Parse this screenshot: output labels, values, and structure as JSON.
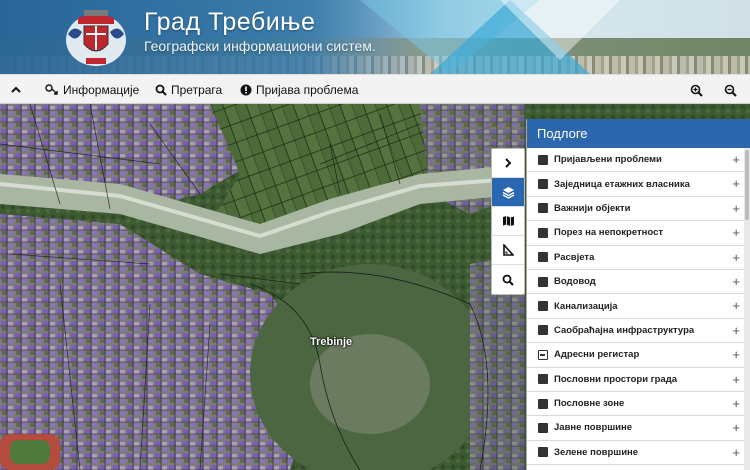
{
  "header": {
    "title": "Град Требиње",
    "subtitle": "Географски информациони систем."
  },
  "toolbar": {
    "collapse_icon": "chevron-up-icon",
    "info_label": "Информације",
    "search_label": "Претрага",
    "report_label": "Пријава проблема",
    "zoom_in_icon": "zoom-in-icon",
    "zoom_out_icon": "zoom-out-icon"
  },
  "map": {
    "place_label": "Trebinje"
  },
  "vtools": [
    "chevron-right-icon",
    "layers-icon",
    "map-icon",
    "measure-icon",
    "search-icon"
  ],
  "panel": {
    "title": "Подлоге",
    "layers": [
      {
        "label": "Пријављени проблеми",
        "state": "checked"
      },
      {
        "label": "Заједница етажних власника",
        "state": "checked"
      },
      {
        "label": "Важнији објекти",
        "state": "checked"
      },
      {
        "label": "Порез на непокретност",
        "state": "checked"
      },
      {
        "label": "Расвјета",
        "state": "checked"
      },
      {
        "label": "Водовод",
        "state": "checked"
      },
      {
        "label": "Канализација",
        "state": "checked"
      },
      {
        "label": "Саобраћајна инфраструктура",
        "state": "checked"
      },
      {
        "label": "Адресни регистар",
        "state": "partial"
      },
      {
        "label": "Пословни простори града",
        "state": "checked"
      },
      {
        "label": "Пословне зоне",
        "state": "checked"
      },
      {
        "label": "Јавне површине",
        "state": "checked"
      },
      {
        "label": "Зелене површине",
        "state": "checked"
      }
    ]
  },
  "colors": {
    "accent": "#2c67ad",
    "toolbar_bg": "#f3f3f3"
  }
}
